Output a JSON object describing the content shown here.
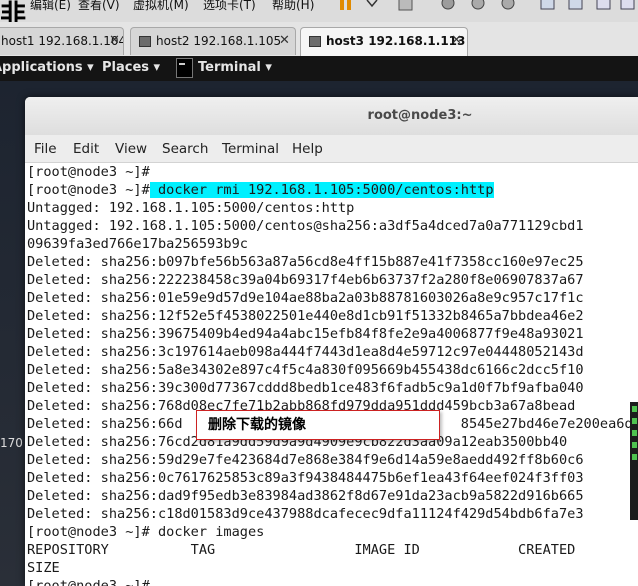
{
  "vm_menu": {
    "logo_char": "非",
    "items": [
      "编辑(E)",
      "查看(V)",
      "虚拟机(M)",
      "选项卡(T)",
      "帮助(H)"
    ]
  },
  "vm_tabs": [
    {
      "label": "host1 192.168.1.104",
      "active": false
    },
    {
      "label": "host2 192.168.1.105",
      "active": false
    },
    {
      "label": "host3 192.168.1.113",
      "active": true
    }
  ],
  "gnome_bar": {
    "applications": "Applications ▾",
    "places": "Places ▾",
    "terminal": "Terminal ▾"
  },
  "desktop_label": "170",
  "terminal": {
    "title": "root@node3:~",
    "menu": [
      "File",
      "Edit",
      "View",
      "Search",
      "Terminal",
      "Help"
    ],
    "lines": [
      {
        "prompt": "[root@node3 ~]#",
        "cmd": ""
      },
      {
        "prompt": "[root@node3 ~]#",
        "cmd": " docker rmi 192.168.1.105:5000/centos:http"
      },
      {
        "text": "Untagged: 192.168.1.105:5000/centos:http"
      },
      {
        "text": "Untagged: 192.168.1.105:5000/centos@sha256:a3df5a4dced7a0a771129cbd1"
      },
      {
        "text": "09639fa3ed766e17ba256593b9c"
      },
      {
        "text": "Deleted: sha256:b097bfe56b563a87a56cd8e4ff15b887e41f7358cc160e97ec25"
      },
      {
        "text": "Deleted: sha256:222238458c39a04b69317f4eb6b63737f2a280f8e06907837a67"
      },
      {
        "text": "Deleted: sha256:01e59e9d57d9e104ae88ba2a03b88781603026a8e9c957c17f1c"
      },
      {
        "text": "Deleted: sha256:12f52e5f4538022501e440e8d1cb91f51332b8465a7bbdea46e2"
      },
      {
        "text": "Deleted: sha256:39675409b4ed94a4abc15efb84f8fe2e9a4006877f9e48a93021"
      },
      {
        "text": "Deleted: sha256:3c197614aeb098a444f7443d1ea8d4e59712c97e04448052143d"
      },
      {
        "text": "Deleted: sha256:5a8e34302e897c4f5c4a830f095669b455438dc6166c2dcc5f10"
      },
      {
        "text": "Deleted: sha256:39c300d77367cddd8bedb1ce483f6fadb5c9a1d0f7bf9afba040"
      },
      {
        "text": "Deleted: sha256:768d08ec7fe71b2abb868fd979dda951ddd459bcb3a67a8bead"
      },
      {
        "text": "Deleted: sha256:66d                                  8545e27bd46e7e200ea6d"
      },
      {
        "text": "Deleted: sha256:76cd2d81a9dd59d9a9d4909e9cb822d3aa09a12eab3500bb40"
      },
      {
        "text": "Deleted: sha256:59d29e7fe423684d7e868e384f9e6d14a59e8aedd492ff8b60c6"
      },
      {
        "text": "Deleted: sha256:0c7617625853c89a3f9438484475b6ef1ea43f64eef024f3ff03"
      },
      {
        "text": "Deleted: sha256:dad9f95edb3e83984ad3862f8d67e91da23acb9a5822d916b665"
      },
      {
        "text": "Deleted: sha256:c18d01583d9ce437988dcafecec9dfa11124f429d54bdb6fa7e3"
      },
      {
        "prompt": "[root@node3 ~]#",
        "cmd": " docker images"
      },
      {
        "text": "REPOSITORY          TAG                 IMAGE ID            CREATED"
      },
      {
        "text": "SIZE"
      },
      {
        "prompt": "[root@node3 ~]#",
        "cmd": ""
      }
    ],
    "annotation": "删除下载的镜像"
  }
}
